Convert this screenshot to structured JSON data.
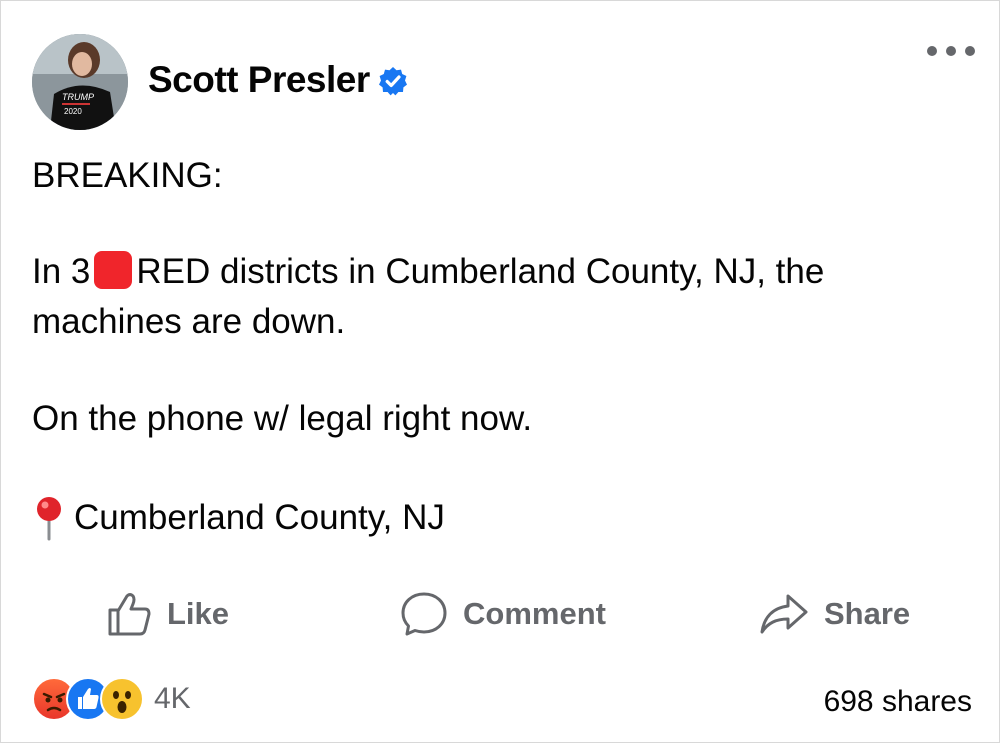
{
  "post": {
    "author": "Scott Presler",
    "avatar_shirt_text": [
      "TRUMP",
      "2020"
    ],
    "lines": {
      "breaking": "BREAKING:",
      "line2_a": "In 3",
      "line2_b": "RED districts in Cumberland County, NJ, the machines are down.",
      "line3": "On the phone w/ legal right now.",
      "location": "Cumberland County, NJ"
    }
  },
  "actions": {
    "like": "Like",
    "comment": "Comment",
    "share": "Share"
  },
  "footer": {
    "reaction_count": "4K",
    "shares": "698 shares",
    "reactions": [
      "angry",
      "like",
      "wow"
    ]
  },
  "colors": {
    "verified": "#1877f2",
    "red_square": "#f0252b",
    "muted": "#65676b"
  }
}
